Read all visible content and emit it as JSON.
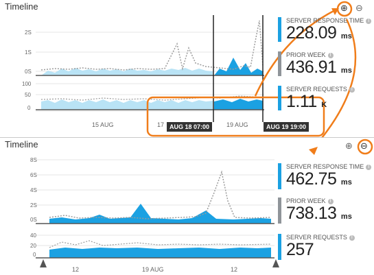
{
  "top": {
    "title": "Timeline",
    "zoom_in": "⊕",
    "zoom_out": "⊖",
    "y_labels_a": [
      "2S",
      "1S",
      "0S"
    ],
    "y_labels_b": [
      "100",
      "50",
      "0"
    ],
    "x_labels": [
      "15 AUG",
      "17",
      "19 AUG"
    ],
    "tooltip_start": "AUG 18 07:00",
    "tooltip_end": "AUG 19 19:00",
    "metrics": [
      {
        "label": "SERVER RESPONSE TIME",
        "value": "228.09",
        "unit": "ms",
        "color": "#1ba1e2"
      },
      {
        "label": "PRIOR WEEK",
        "value": "436.91",
        "unit": "ms",
        "color": "#8f9499"
      },
      {
        "label": "SERVER REQUESTS",
        "value": "1.11",
        "unit": "K",
        "color": "#1ba1e2"
      }
    ]
  },
  "bottom": {
    "title": "Timeline",
    "zoom_in": "⊕",
    "zoom_out": "⊖",
    "y_labels_a": [
      "8S",
      "6S",
      "4S",
      "2S",
      "0S"
    ],
    "y_labels_b": [
      "40",
      "20",
      "0"
    ],
    "x_labels": [
      "12",
      "19 AUG",
      "12"
    ],
    "metrics": [
      {
        "label": "SERVER RESPONSE TIME",
        "value": "462.75",
        "unit": "ms",
        "color": "#1ba1e2"
      },
      {
        "label": "PRIOR WEEK",
        "value": "738.13",
        "unit": "ms",
        "color": "#8f9499"
      },
      {
        "label": "SERVER REQUESTS",
        "value": "257",
        "unit": "",
        "color": "#1ba1e2"
      }
    ]
  },
  "colors": {
    "series": "#1ba1e2",
    "series_light": "#b9e3f5",
    "prior": "#9a9a9a",
    "annotation": "#f07d1a"
  }
}
